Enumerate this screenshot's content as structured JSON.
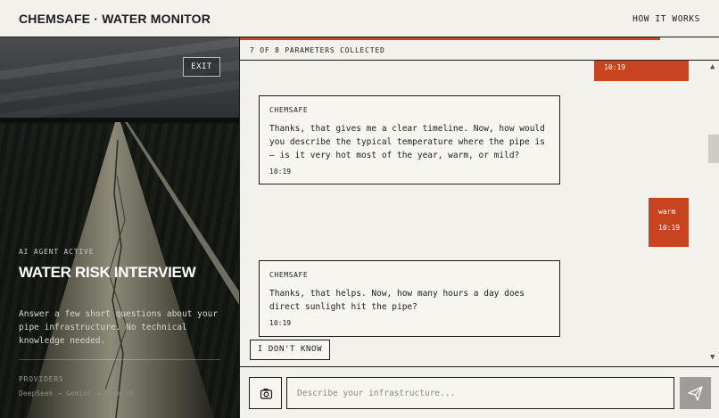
{
  "header": {
    "brand": "CHEMSAFE · WATER MONITOR",
    "how_it_works": "HOW IT WORKS"
  },
  "sidebar": {
    "exit": "EXIT",
    "agent_status": "AI AGENT ACTIVE",
    "title": "WATER RISK INTERVIEW",
    "description": "Answer a few short questions about your pipe infrastructure. No technical knowledge needed.",
    "providers_label": "PROVIDERS",
    "providers": "DeepSeek → Gemini → Neon db"
  },
  "progress": {
    "collected": 7,
    "total": 8,
    "label": "7 OF 8 PARAMETERS COLLECTED"
  },
  "messages": [
    {
      "role": "user",
      "text": "",
      "time": "10:19"
    },
    {
      "role": "agent",
      "sender": "CHEMSAFE",
      "text": "Thanks, that gives me a clear timeline. Now, how would you describe the typical temperature where the pipe is — is it very hot most of the year, warm, or mild?",
      "time": "10:19"
    },
    {
      "role": "user",
      "text": "warm",
      "time": "10:19"
    },
    {
      "role": "agent",
      "sender": "CHEMSAFE",
      "text": "Thanks, that helps. Now, how many hours a day does direct sunlight hit the pipe?",
      "time": "10:19"
    }
  ],
  "quick_reply": "I DON'T KNOW",
  "composer": {
    "placeholder": "Describe your infrastructure..."
  },
  "icons": {
    "camera": "camera-icon",
    "send": "send-icon",
    "scroll_up": "chevron-up-icon",
    "scroll_down": "chevron-down-icon"
  },
  "colors": {
    "accent": "#c9431e",
    "background": "#f3f1ec",
    "ink": "#1c1c1c"
  }
}
